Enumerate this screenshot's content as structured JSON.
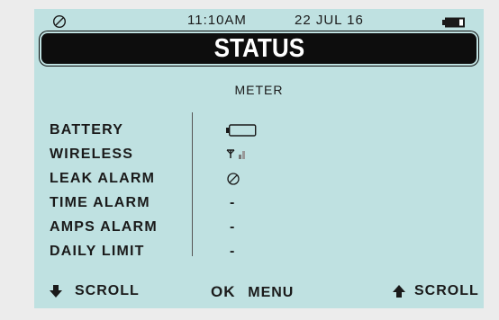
{
  "status_bar": {
    "icon": "no-entry-icon",
    "time": "11:10AM",
    "date": "22 JUL 16",
    "battery_icon": "battery-icon"
  },
  "title": "STATUS",
  "subtitle": "METER",
  "rows": [
    {
      "label": "BATTERY",
      "value": "",
      "icon": "battery-low-icon"
    },
    {
      "label": "WIRELESS",
      "value": "",
      "icon": "antenna-signal-icon"
    },
    {
      "label": "LEAK ALARM",
      "value": "",
      "icon": "no-entry-icon"
    },
    {
      "label": "TIME ALARM",
      "value": "-"
    },
    {
      "label": "AMPS ALARM",
      "value": "-"
    },
    {
      "label": "DAILY LIMIT",
      "value": "-"
    }
  ],
  "footer": {
    "left_label": "SCROLL",
    "ok_label": "OK",
    "menu_label": "MENU",
    "right_label": "SCROLL"
  },
  "colors": {
    "screen_bg": "#bfe1e1",
    "title_bg": "#0d0d0d",
    "text": "#1a1a1a"
  }
}
